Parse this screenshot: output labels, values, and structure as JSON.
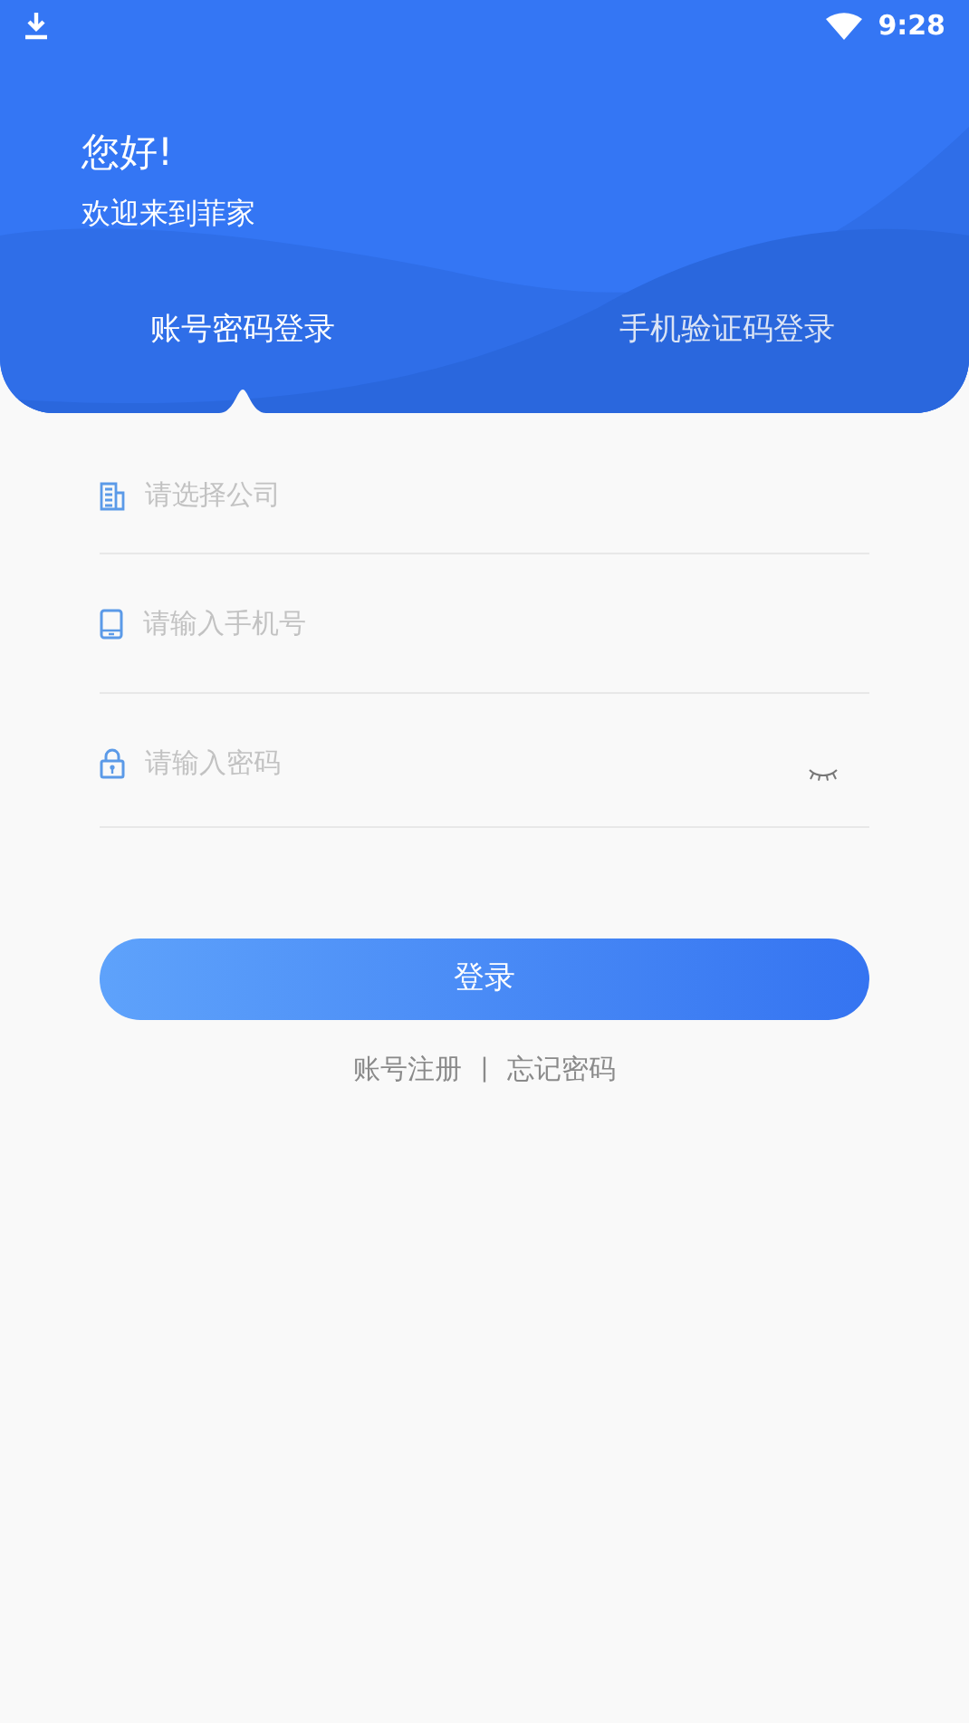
{
  "status_bar": {
    "time": "9:28"
  },
  "header": {
    "greeting": "您好!",
    "welcome": "欢迎来到菲家"
  },
  "tabs": [
    {
      "label": "账号密码登录",
      "selected": true
    },
    {
      "label": "手机验证码登录",
      "selected": false
    }
  ],
  "fields": [
    {
      "kind": "company",
      "placeholder": "请选择公司"
    },
    {
      "kind": "phone",
      "placeholder": "请输入手机号"
    },
    {
      "kind": "password",
      "placeholder": "请输入密码"
    }
  ],
  "login_button": "登录",
  "links": [
    {
      "label": "账号注册"
    },
    {
      "label": "忘记密码"
    }
  ],
  "link_separator": "|"
}
